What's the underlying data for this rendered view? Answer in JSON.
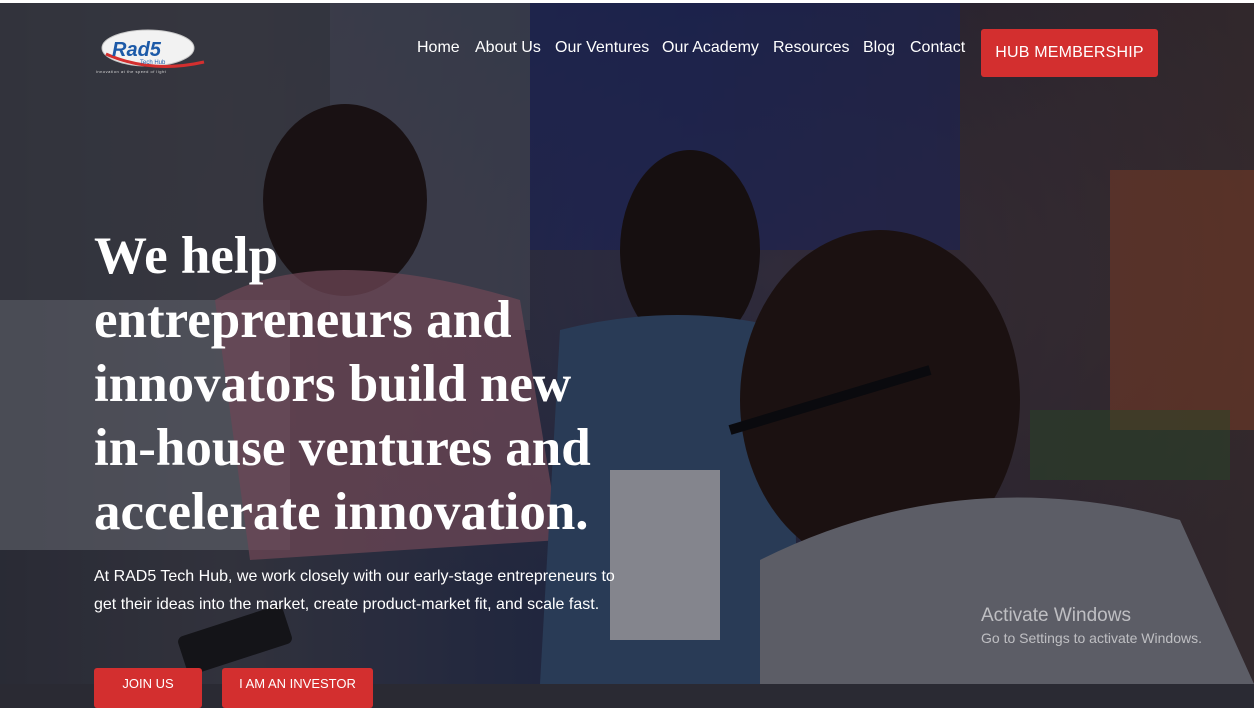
{
  "brand": {
    "logo_text": "Rad5",
    "logo_sub": "Tech Hub",
    "tagline": "innovation at the speed of light"
  },
  "nav": {
    "items": [
      "Home",
      "About Us",
      "Our Ventures",
      "Our Academy",
      "Resources",
      "Blog",
      "Contact"
    ],
    "cta": "HUB MEMBERSHIP"
  },
  "hero": {
    "headline_lines": [
      "We help",
      "entrepreneurs and",
      "innovators build new",
      "in-house ventures and",
      "accelerate innovation."
    ],
    "intro_lines": [
      "At RAD5 Tech Hub, we work closely with our early-stage entrepreneurs to",
      "get their ideas into the market, create product-market fit, and scale fast."
    ],
    "buttons": [
      "JOIN US",
      "I AM AN INVESTOR"
    ]
  },
  "windows_watermark": {
    "title": "Activate Windows",
    "subtitle": "Go to Settings to activate Windows."
  },
  "colors": {
    "accent": "#d32f2f",
    "text": "#ffffff"
  }
}
